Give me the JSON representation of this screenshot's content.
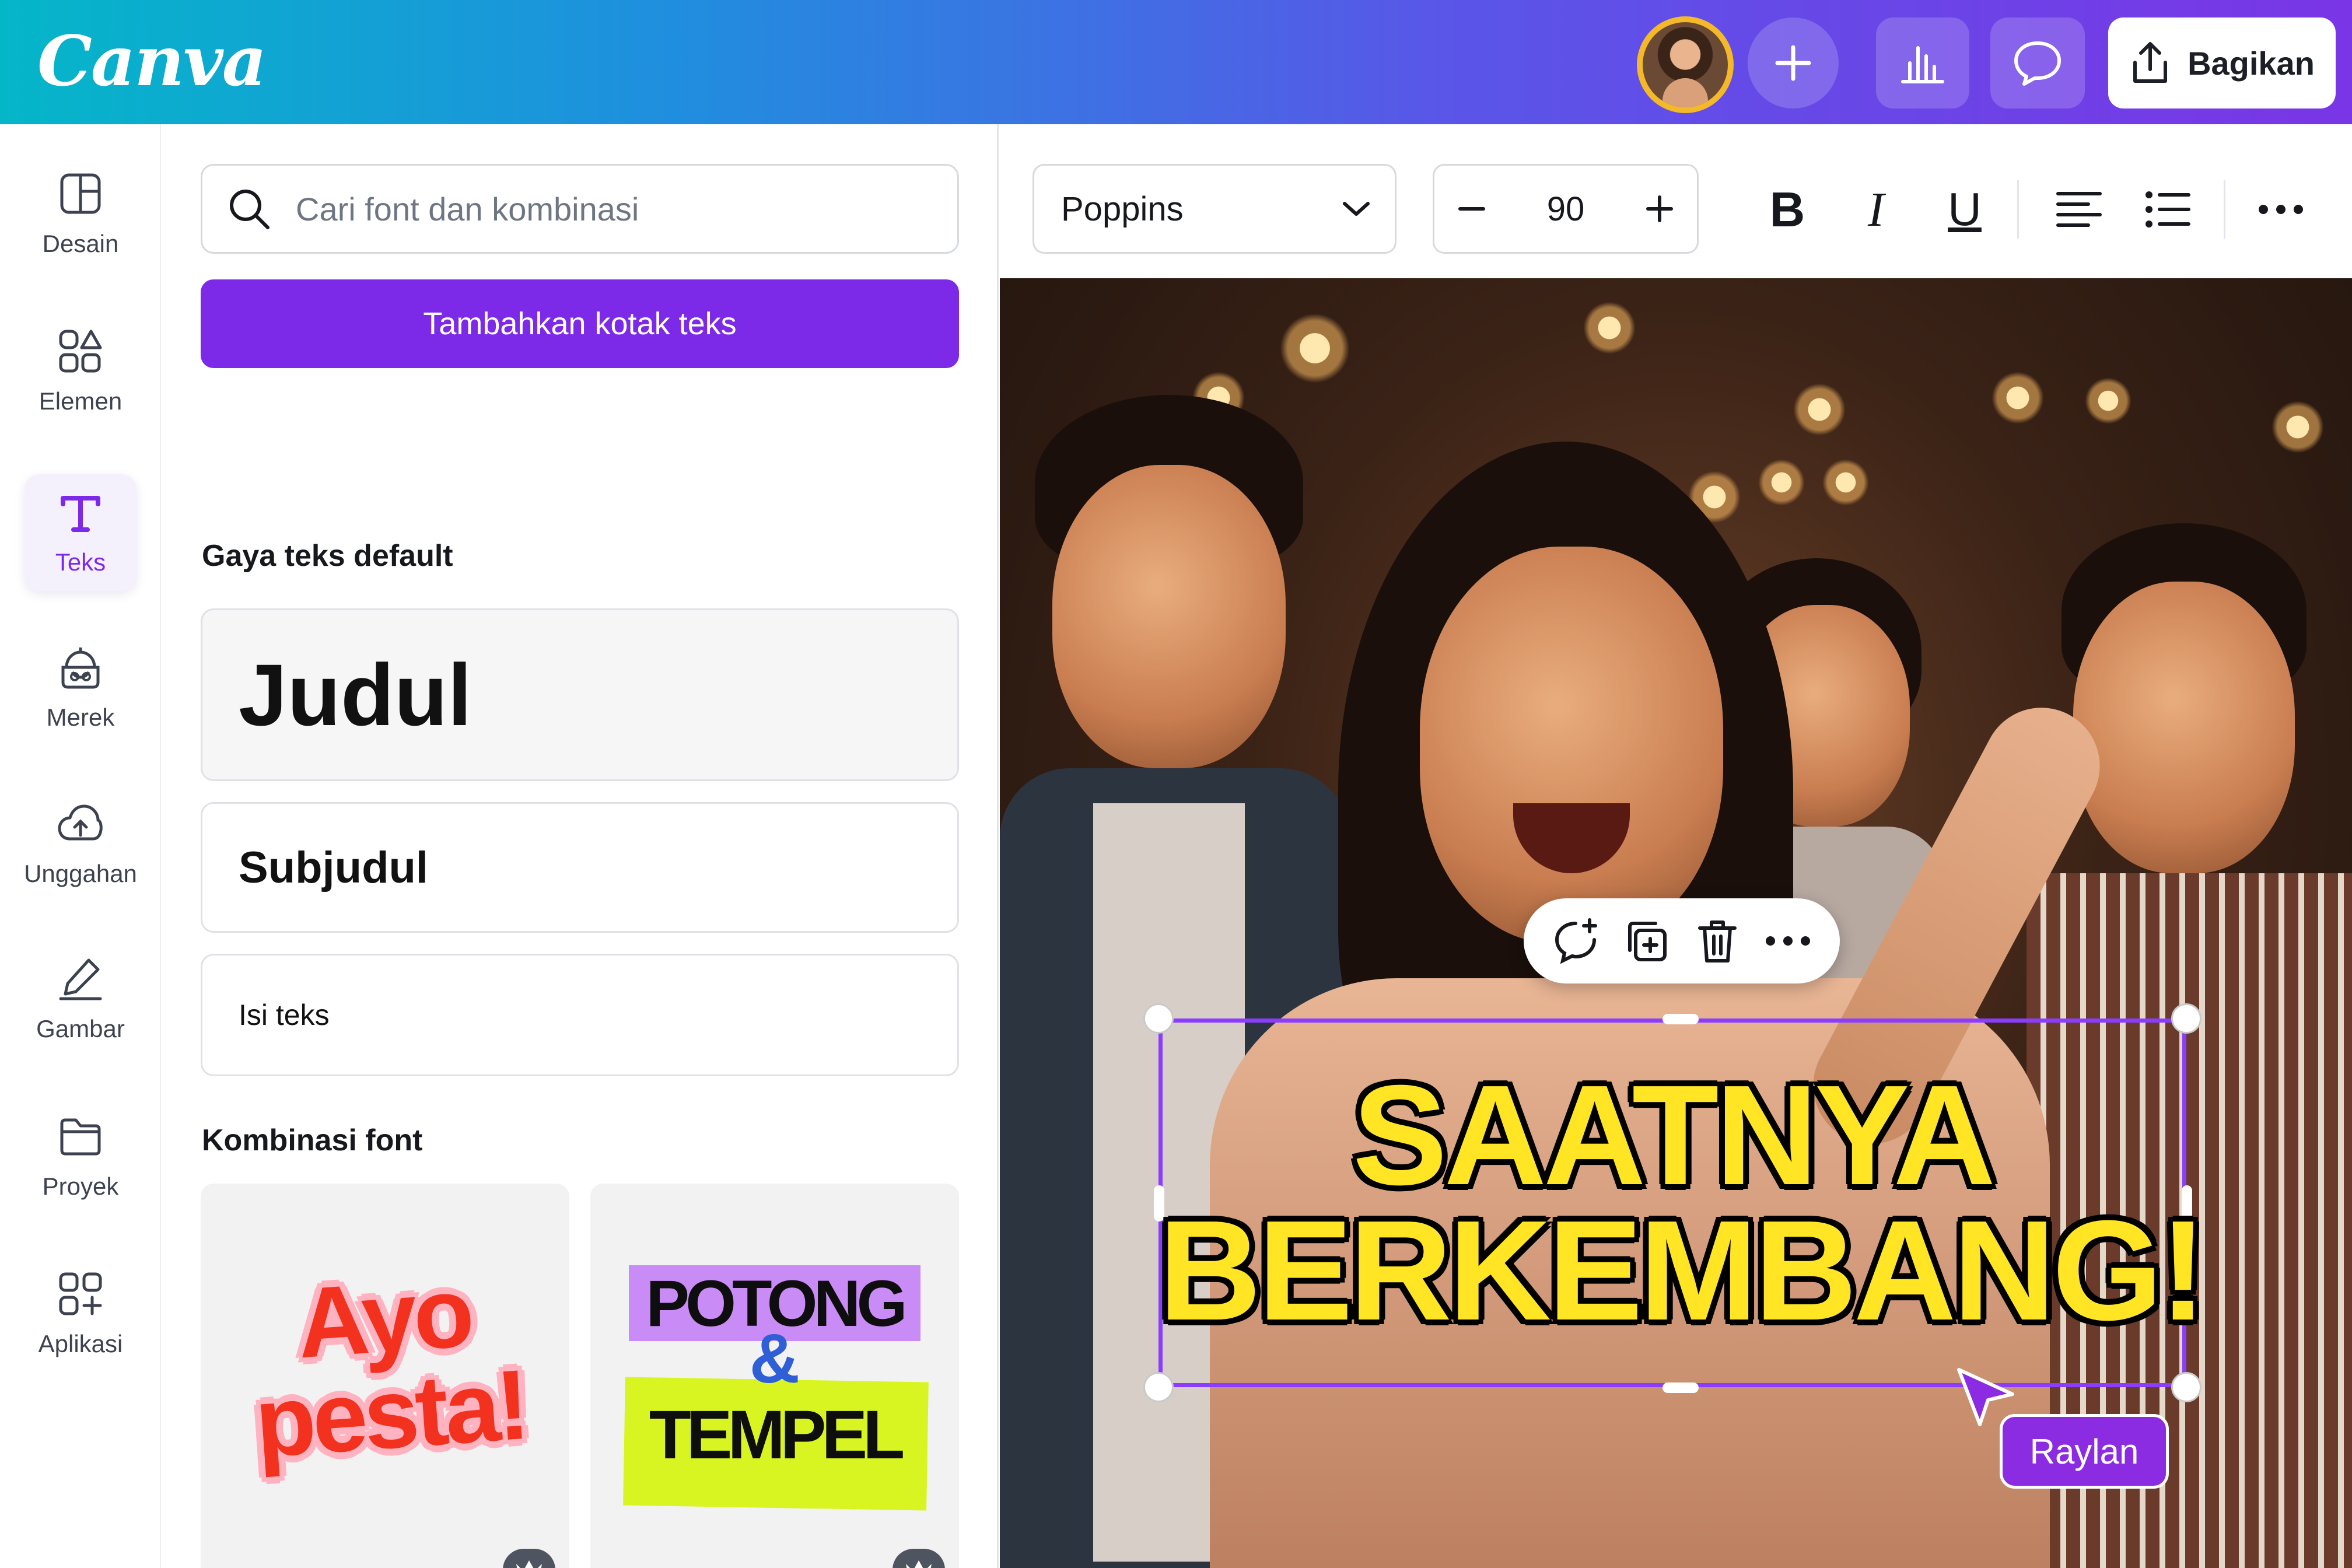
{
  "app": {
    "logo_text": "Canva"
  },
  "topbar": {
    "share_label": "Bagikan",
    "icons": [
      "plus-icon",
      "analytics-icon",
      "comment-icon",
      "share-upload-icon"
    ]
  },
  "rail": {
    "items": [
      {
        "label": "Desain",
        "icon": "layout-icon"
      },
      {
        "label": "Elemen",
        "icon": "shapes-icon"
      },
      {
        "label": "Teks",
        "icon": "text-icon",
        "active": true
      },
      {
        "label": "Merek",
        "icon": "brand-icon"
      },
      {
        "label": "Unggahan",
        "icon": "cloud-upload-icon"
      },
      {
        "label": "Gambar",
        "icon": "draw-icon"
      },
      {
        "label": "Proyek",
        "icon": "folder-icon"
      },
      {
        "label": "Aplikasi",
        "icon": "apps-icon"
      }
    ]
  },
  "panel": {
    "search_placeholder": "Cari font dan kombinasi",
    "add_text_button": "Tambahkan kotak teks",
    "default_styles_title": "Gaya teks default",
    "styles": {
      "heading": "Judul",
      "subheading": "Subjudul",
      "body": "Isi teks"
    },
    "combinations_title": "Kombinasi font",
    "combos": [
      {
        "line1": "Ayo",
        "line2": "pesta!"
      },
      {
        "line1": "POTONG",
        "line2": "&",
        "line3": "TEMPEL"
      }
    ]
  },
  "toolbar": {
    "font_name": "Poppins",
    "font_size": "90",
    "bold": "B",
    "italic": "I",
    "underline": "U"
  },
  "canvas": {
    "headline_line1": "SAATNYA",
    "headline_line2": "BERKEMBANG!",
    "collaborator_name": "Raylan",
    "colors": {
      "accent": "#7d2ae8",
      "headline": "#ffe523",
      "selection": "#8b3dff"
    }
  }
}
